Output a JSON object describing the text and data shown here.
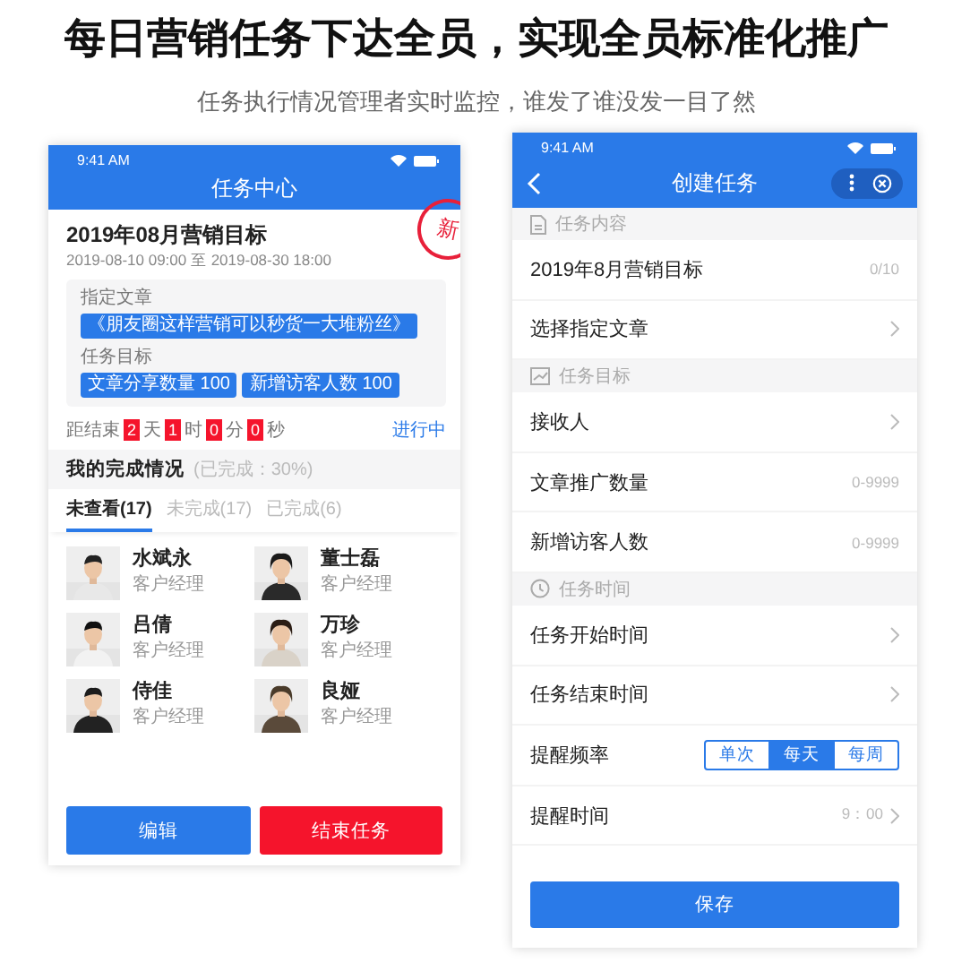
{
  "headline": "每日营销任务下达全员，实现全员标准化推广",
  "subheadline": "任务执行情况管理者实时监控，谁发了谁没发一目了然",
  "left_phone": {
    "status_time": "9:41 AM",
    "title": "任务中心",
    "stamp": "新",
    "task": {
      "title": "2019年08月营销目标",
      "date_range": "2019-08-10 09:00 至 2019-08-30 18:00",
      "article_label": "指定文章",
      "article_tag": "《朋友圈这样营销可以秒货一大堆粉丝》",
      "goal_label": "任务目标",
      "goal_tags": [
        "文章分享数量 100",
        "新增访客人数 100"
      ],
      "countdown": [
        {
          "kind": "text",
          "text": "距结束"
        },
        {
          "kind": "number",
          "text": "2"
        },
        {
          "kind": "text",
          "text": "天"
        },
        {
          "kind": "number",
          "text": "1"
        },
        {
          "kind": "text",
          "text": "时"
        },
        {
          "kind": "number",
          "text": "0"
        },
        {
          "kind": "text",
          "text": "分"
        },
        {
          "kind": "number",
          "text": "0"
        },
        {
          "kind": "text",
          "text": "秒"
        }
      ],
      "status": "进行中"
    },
    "progress": {
      "title": "我的完成情况",
      "note": "(已完成：30%)"
    },
    "tabs": [
      {
        "label": "未查看(17)",
        "selected": true
      },
      {
        "label": "未完成(17)",
        "selected": false
      },
      {
        "label": "已完成(6)",
        "selected": false
      }
    ],
    "people": [
      {
        "name": "水斌永",
        "role": "客户经理"
      },
      {
        "name": "董士磊",
        "role": "客户经理"
      },
      {
        "name": "吕倩",
        "role": "客户经理"
      },
      {
        "name": "万珍",
        "role": "客户经理"
      },
      {
        "name": "侍佳",
        "role": "客户经理"
      },
      {
        "name": "良娅",
        "role": "客户经理"
      }
    ],
    "buttons": [
      {
        "label": "编辑",
        "kind": "primary"
      },
      {
        "label": "结束任务",
        "kind": "danger"
      }
    ]
  },
  "right_phone": {
    "status_time": "9:41 AM",
    "title": "创建任务",
    "rows": [
      {
        "kind": "header",
        "label": "任务内容"
      },
      {
        "kind": "value",
        "label": "2019年8月营销目标",
        "counter": "0/10"
      },
      {
        "kind": "link",
        "label": "选择指定文章"
      },
      {
        "kind": "header",
        "label": "任务目标"
      },
      {
        "kind": "link",
        "label": "接收人"
      },
      {
        "kind": "input",
        "label": "文章推广数量",
        "placeholder": "0-9999"
      },
      {
        "kind": "input",
        "label": "新增访客人数",
        "placeholder": "0-9999"
      },
      {
        "kind": "header",
        "label": "任务时间"
      },
      {
        "kind": "link",
        "label": "任务开始时间"
      },
      {
        "kind": "link",
        "label": "任务结束时间"
      },
      {
        "kind": "segmented",
        "label": "提醒频率",
        "options": [
          {
            "label": "单次",
            "selected": false
          },
          {
            "label": "每天",
            "selected": true
          },
          {
            "label": "每周",
            "selected": false
          }
        ]
      },
      {
        "kind": "link",
        "label": "提醒时间",
        "value": "9：00"
      }
    ],
    "save": "保存"
  }
}
